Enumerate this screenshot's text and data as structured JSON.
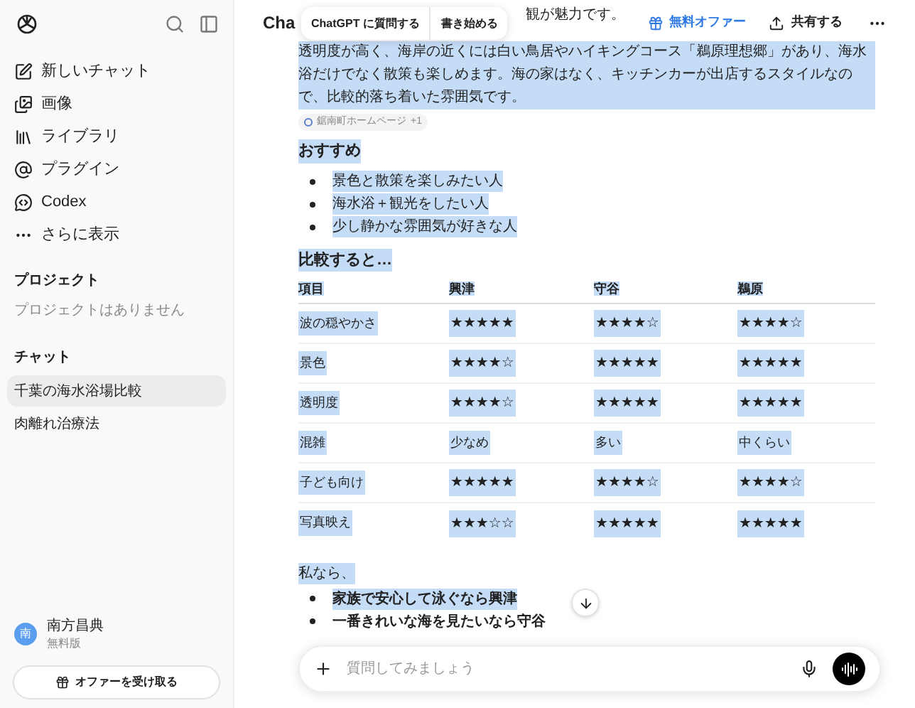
{
  "sidebar": {
    "nav": [
      {
        "label": "新しいチャット",
        "kind": "new"
      },
      {
        "label": "画像",
        "kind": "image"
      },
      {
        "label": "ライブラリ",
        "kind": "library"
      },
      {
        "label": "プラグイン",
        "kind": "plugin"
      },
      {
        "label": "Codex",
        "kind": "codex"
      },
      {
        "label": "さらに表示",
        "kind": "more"
      }
    ],
    "projects": {
      "heading": "プロジェクト",
      "empty": "プロジェクトはありません"
    },
    "chats": {
      "heading": "チャット",
      "items": [
        {
          "label": "千葉の海水浴場比較",
          "selected": true
        },
        {
          "label": "肉離れ治療法",
          "selected": false
        }
      ]
    },
    "user": {
      "initial": "南",
      "name": "南方昌典",
      "plan": "無料版"
    },
    "offer_button": "オファーを受け取る"
  },
  "header": {
    "title": "Cha",
    "offer": "無料オファー",
    "share": "共有する"
  },
  "popover": [
    "ChatGPT に質問する",
    "書き始める"
  ],
  "message": {
    "top_fragment": "観が魅力です。",
    "paragraph": {
      "text": "透明度が高く、海岸の近くには白い鳥居やハイキングコース「鵜原理想郷」があり、海水浴だけでなく散策も楽しめます。海の家はなく、キッチンカーが出店するスタイルなので、比較的落ち着いた雰囲気です。",
      "highlighted": true
    },
    "source": {
      "label": "鋸南町ホームページ",
      "extra": "+1"
    },
    "recommend": {
      "heading": "おすすめ",
      "highlighted": true,
      "items": [
        {
          "text": "景色と散策を楽しみたい人",
          "highlighted": true
        },
        {
          "text": "海水浴＋観光をしたい人",
          "highlighted": true
        },
        {
          "text": "少し静かな雰囲気が好きな人",
          "highlighted": true
        }
      ]
    },
    "compare_heading": {
      "text": "比較すると…",
      "highlighted": true
    },
    "table": {
      "highlighted": true,
      "columns": [
        "項目",
        "興津",
        "守谷",
        "鵜原"
      ],
      "rows": [
        [
          "波の穏やかさ",
          "★★★★★",
          "★★★★☆",
          "★★★★☆"
        ],
        [
          "景色",
          "★★★★☆",
          "★★★★★",
          "★★★★★"
        ],
        [
          "透明度",
          "★★★★☆",
          "★★★★★",
          "★★★★★"
        ],
        [
          "混雑",
          "少なめ",
          "多い",
          "中くらい"
        ],
        [
          "子ども向け",
          "★★★★★",
          "★★★★☆",
          "★★★★☆"
        ],
        [
          "写真映え",
          "★★★☆☆",
          "★★★★★",
          "★★★★★"
        ]
      ]
    },
    "closing": {
      "text": "私なら、",
      "highlighted": true
    },
    "picks": [
      {
        "text": "家族で安心して泳ぐなら興津",
        "highlighted": true
      },
      {
        "text": "一番きれいな海を見たいなら守谷",
        "highlighted": false
      }
    ]
  },
  "composer": {
    "placeholder": "質問してみましょう"
  }
}
